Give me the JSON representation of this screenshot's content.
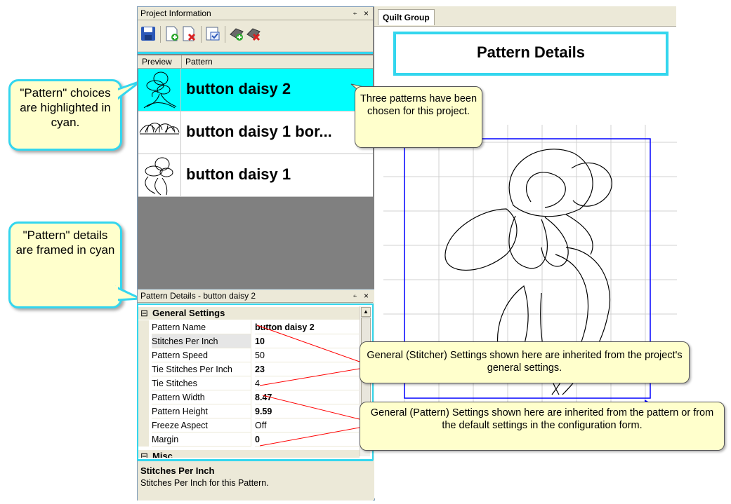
{
  "callouts": {
    "pattern_choices": "\"Pattern\" choices are highlighted in cyan.",
    "pattern_details": "\"Pattern\" details are framed in cyan"
  },
  "project_panel": {
    "title": "Project Information",
    "pin_glyph": "⍅",
    "close_glyph": "×",
    "toolbar_icons": [
      "save-icon",
      "add-pattern-icon",
      "remove-pattern-icon",
      "pattern-properties-icon",
      "add-group-icon",
      "remove-group-icon"
    ],
    "columns": [
      "Preview",
      "Pattern"
    ],
    "patterns": [
      {
        "name": "button daisy 2",
        "selected": true
      },
      {
        "name": "button daisy 1 bor...",
        "selected": false
      },
      {
        "name": "button daisy 1",
        "selected": false
      }
    ]
  },
  "details_panel": {
    "title": "Pattern Details - button daisy 2",
    "category_general": "General Settings",
    "category_misc": "Misc",
    "properties": [
      {
        "key": "Pattern Name",
        "value": "button daisy 2",
        "bold": true
      },
      {
        "key": "Stitches Per Inch",
        "value": "10",
        "bold": true
      },
      {
        "key": "Pattern Speed",
        "value": "50",
        "bold": false
      },
      {
        "key": "Tie Stitches Per Inch",
        "value": "23",
        "bold": true
      },
      {
        "key": "Tie Stitches",
        "value": "4",
        "bold": false
      },
      {
        "key": "Pattern Width",
        "value": "8.47",
        "bold": true
      },
      {
        "key": "Pattern Height",
        "value": "9.59",
        "bold": true
      },
      {
        "key": "Freeze Aspect",
        "value": "Off",
        "bold": false
      },
      {
        "key": "Margin",
        "value": "0",
        "bold": true
      }
    ],
    "help_title": "Stitches Per Inch",
    "help_text": "Stitches Per Inch for this Pattern."
  },
  "quilt": {
    "tab": "Quilt Group",
    "heading": "Pattern Details",
    "note_chosen": "Three patterns have been chosen for this project.",
    "note_stitcher": "General (Stitcher) Settings shown here are inherited from the project's general settings.",
    "note_pattern": "General (Pattern) Settings shown here are inherited from the pattern or from the default settings in the configuration form."
  },
  "colors": {
    "cyan": "#00ffff",
    "frame_cyan": "#33d6ee",
    "note_bg": "#ffffcc",
    "pattern_outline": "#0000ff",
    "leader_line": "#ff0000"
  }
}
